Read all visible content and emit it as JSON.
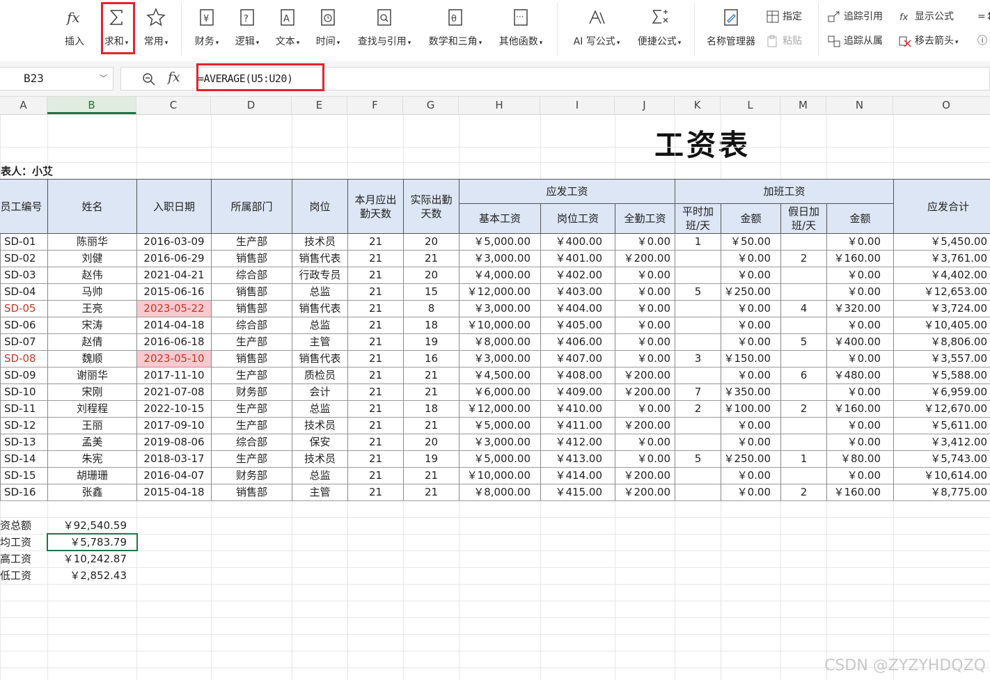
{
  "ribbon": {
    "insert_label": "插入",
    "sum_label": "求和",
    "common_label": "常用",
    "finance_label": "财务",
    "logic_label": "逻辑",
    "text_label": "文本",
    "time_label": "时间",
    "lookup_label": "查找与引用",
    "math_label": "数学和三角",
    "other_label": "其他函数",
    "ai_label": "AI 写公式",
    "quick_label": "便捷公式",
    "name_mgr_label": "名称管理器",
    "specify_label": "指定",
    "paste_label": "粘贴",
    "trace_prec_label": "追踪引用",
    "trace_dep_label": "追踪从属",
    "show_formula_label": "显示公式",
    "remove_arrows_label": "移去箭头",
    "dropdown_arrow": "▾"
  },
  "formula_bar": {
    "name_box": "B23",
    "fx": "fx",
    "formula": "=AVERAGE(U5:U20)"
  },
  "columns": [
    "A",
    "B",
    "C",
    "D",
    "E",
    "F",
    "G",
    "H",
    "I",
    "J",
    "K",
    "L",
    "M",
    "N",
    "O"
  ],
  "selected_column": "B",
  "sheet": {
    "title": "工资表",
    "maker": "制表人：小艾",
    "headers": {
      "emp_no": "员工编号",
      "name": "姓名",
      "hire_date": "入职日期",
      "dept": "所属部门",
      "post": "岗位",
      "due_days": "本月应出勤天数",
      "actual_days": "实际出勤天数",
      "pay_group": "应发工资",
      "base": "基本工资",
      "post_pay": "岗位工资",
      "attendance": "全勤工资",
      "ot_group": "加班工资",
      "weekday_ot": "平时加班/天",
      "amount1": "金额",
      "holiday_ot": "假日加班/天",
      "amount2": "金额",
      "total": "应发合计"
    },
    "rows": [
      [
        "SD-01",
        "陈丽华",
        "2016-03-09",
        "生产部",
        "技术员",
        "21",
        "20",
        "￥5,000.00",
        "￥400.00",
        "￥0.00",
        "1",
        "￥50.00",
        "",
        "￥0.00",
        "￥5,450.00"
      ],
      [
        "SD-02",
        "刘健",
        "2016-06-29",
        "销售部",
        "销售代表",
        "21",
        "21",
        "￥3,000.00",
        "￥401.00",
        "￥200.00",
        "",
        "￥0.00",
        "2",
        "￥160.00",
        "￥3,761.00"
      ],
      [
        "SD-03",
        "赵伟",
        "2021-04-21",
        "综合部",
        "行政专员",
        "21",
        "20",
        "￥4,000.00",
        "￥402.00",
        "￥0.00",
        "",
        "￥0.00",
        "",
        "￥0.00",
        "￥4,402.00"
      ],
      [
        "SD-04",
        "马帅",
        "2015-06-16",
        "销售部",
        "总监",
        "21",
        "15",
        "￥12,000.00",
        "￥403.00",
        "￥0.00",
        "5",
        "￥250.00",
        "",
        "￥0.00",
        "￥12,653.00"
      ],
      [
        "SD-05",
        "王亮",
        "2023-05-22",
        "销售部",
        "销售代表",
        "21",
        "8",
        "￥3,000.00",
        "￥404.00",
        "￥0.00",
        "",
        "￥0.00",
        "4",
        "￥320.00",
        "￥3,724.00"
      ],
      [
        "SD-06",
        "宋涛",
        "2014-04-18",
        "综合部",
        "总监",
        "21",
        "18",
        "￥10,000.00",
        "￥405.00",
        "￥0.00",
        "",
        "￥0.00",
        "",
        "￥0.00",
        "￥10,405.00"
      ],
      [
        "SD-07",
        "赵倩",
        "2016-06-18",
        "生产部",
        "主管",
        "21",
        "19",
        "￥8,000.00",
        "￥406.00",
        "￥0.00",
        "",
        "￥0.00",
        "5",
        "￥400.00",
        "￥8,806.00"
      ],
      [
        "SD-08",
        "魏顺",
        "2023-05-10",
        "销售部",
        "销售代表",
        "21",
        "16",
        "￥3,000.00",
        "￥407.00",
        "￥0.00",
        "3",
        "￥150.00",
        "",
        "￥0.00",
        "￥3,557.00"
      ],
      [
        "SD-09",
        "谢丽华",
        "2017-11-10",
        "生产部",
        "质检员",
        "21",
        "21",
        "￥4,500.00",
        "￥408.00",
        "￥200.00",
        "",
        "￥0.00",
        "6",
        "￥480.00",
        "￥5,588.00"
      ],
      [
        "SD-10",
        "宋刚",
        "2021-07-08",
        "财务部",
        "会计",
        "21",
        "21",
        "￥6,000.00",
        "￥409.00",
        "￥200.00",
        "7",
        "￥350.00",
        "",
        "￥0.00",
        "￥6,959.00"
      ],
      [
        "SD-11",
        "刘程程",
        "2022-10-15",
        "生产部",
        "总监",
        "21",
        "18",
        "￥12,000.00",
        "￥410.00",
        "￥0.00",
        "2",
        "￥100.00",
        "2",
        "￥160.00",
        "￥12,670.00"
      ],
      [
        "SD-12",
        "王丽",
        "2017-09-10",
        "生产部",
        "技术员",
        "21",
        "21",
        "￥5,000.00",
        "￥411.00",
        "￥200.00",
        "",
        "￥0.00",
        "",
        "￥0.00",
        "￥5,611.00"
      ],
      [
        "SD-13",
        "孟美",
        "2019-08-06",
        "综合部",
        "保安",
        "21",
        "20",
        "￥3,000.00",
        "￥412.00",
        "￥0.00",
        "",
        "￥0.00",
        "",
        "￥0.00",
        "￥3,412.00"
      ],
      [
        "SD-14",
        "朱宪",
        "2018-03-17",
        "生产部",
        "技术员",
        "21",
        "19",
        "￥5,000.00",
        "￥413.00",
        "￥0.00",
        "5",
        "￥250.00",
        "1",
        "￥80.00",
        "￥5,743.00"
      ],
      [
        "SD-15",
        "胡珊珊",
        "2016-04-07",
        "财务部",
        "总监",
        "21",
        "21",
        "￥10,000.00",
        "￥414.00",
        "￥200.00",
        "",
        "￥0.00",
        "",
        "￥0.00",
        "￥10,614.00"
      ],
      [
        "SD-16",
        "张鑫",
        "2015-04-18",
        "销售部",
        "主管",
        "21",
        "21",
        "￥8,000.00",
        "￥415.00",
        "￥200.00",
        "",
        "￥0.00",
        "2",
        "￥160.00",
        "￥8,775.00"
      ]
    ],
    "highlighted_rows": [
      4,
      7
    ],
    "summary": [
      {
        "label": "工资总额",
        "value": "￥92,540.59"
      },
      {
        "label": "平均工资",
        "value": "￥5,783.79"
      },
      {
        "label": "最高工资",
        "value": "￥10,242.87"
      },
      {
        "label": "最低工资",
        "value": "￥2,852.43"
      }
    ]
  },
  "watermark": "CSDN @ZYZYHDQZQ",
  "colors": {
    "highlight": "#f8c9cf",
    "red": "#e4232a",
    "header_fill": "#dce6f4",
    "select_green": "#217346"
  }
}
